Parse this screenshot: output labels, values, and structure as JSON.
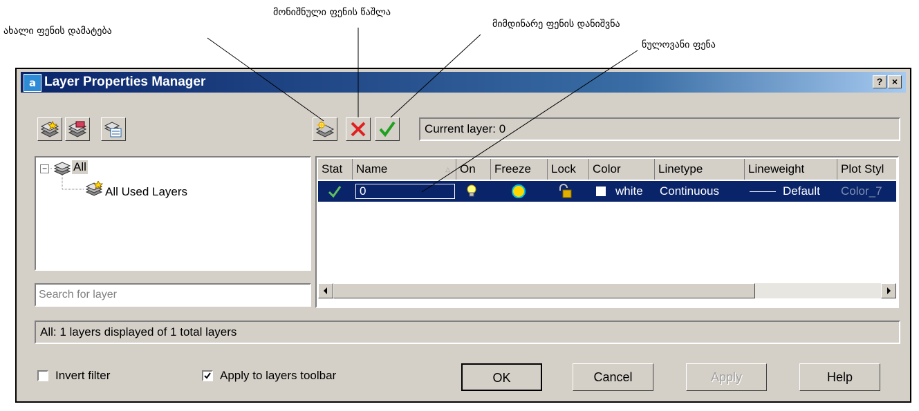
{
  "annotations": {
    "new_layer": "ახალი ფენის დამატება",
    "delete_layer": "მონიშნული ფენის წაშლა",
    "set_current": "მიმდინარე ფენის დანიშვნა",
    "zero_layer": "ნულოვანი ფენა"
  },
  "window": {
    "title": "Layer Properties Manager",
    "help_button": "?",
    "close_button": "×"
  },
  "current_layer": "Current layer: 0",
  "filter_tree": {
    "root": "All",
    "child": "All Used Layers"
  },
  "search": {
    "placeholder": "Search for layer"
  },
  "table": {
    "columns": [
      "Stat",
      "Name",
      "On",
      "Freeze",
      "Lock",
      "Color",
      "Linetype",
      "Lineweight",
      "Plot Styl"
    ],
    "rows": [
      {
        "name": "0",
        "color": "white",
        "linetype": "Continuous",
        "lineweight": "Default",
        "plot_style": "Color_7"
      }
    ]
  },
  "status_text": "All: 1 layers displayed of 1 total layers",
  "options": {
    "invert_filter": {
      "label": "Invert filter",
      "checked": false
    },
    "apply_toolbar": {
      "label": "Apply to layers toolbar",
      "checked": true
    }
  },
  "buttons": {
    "ok": "OK",
    "cancel": "Cancel",
    "apply": "Apply",
    "help": "Help"
  },
  "colors": {
    "title_start": "#0a246a",
    "title_end": "#a6caf0",
    "selection": "#0a246a",
    "face": "#d4d0c8",
    "delete_red": "#e02020",
    "check_green": "#20a020"
  }
}
